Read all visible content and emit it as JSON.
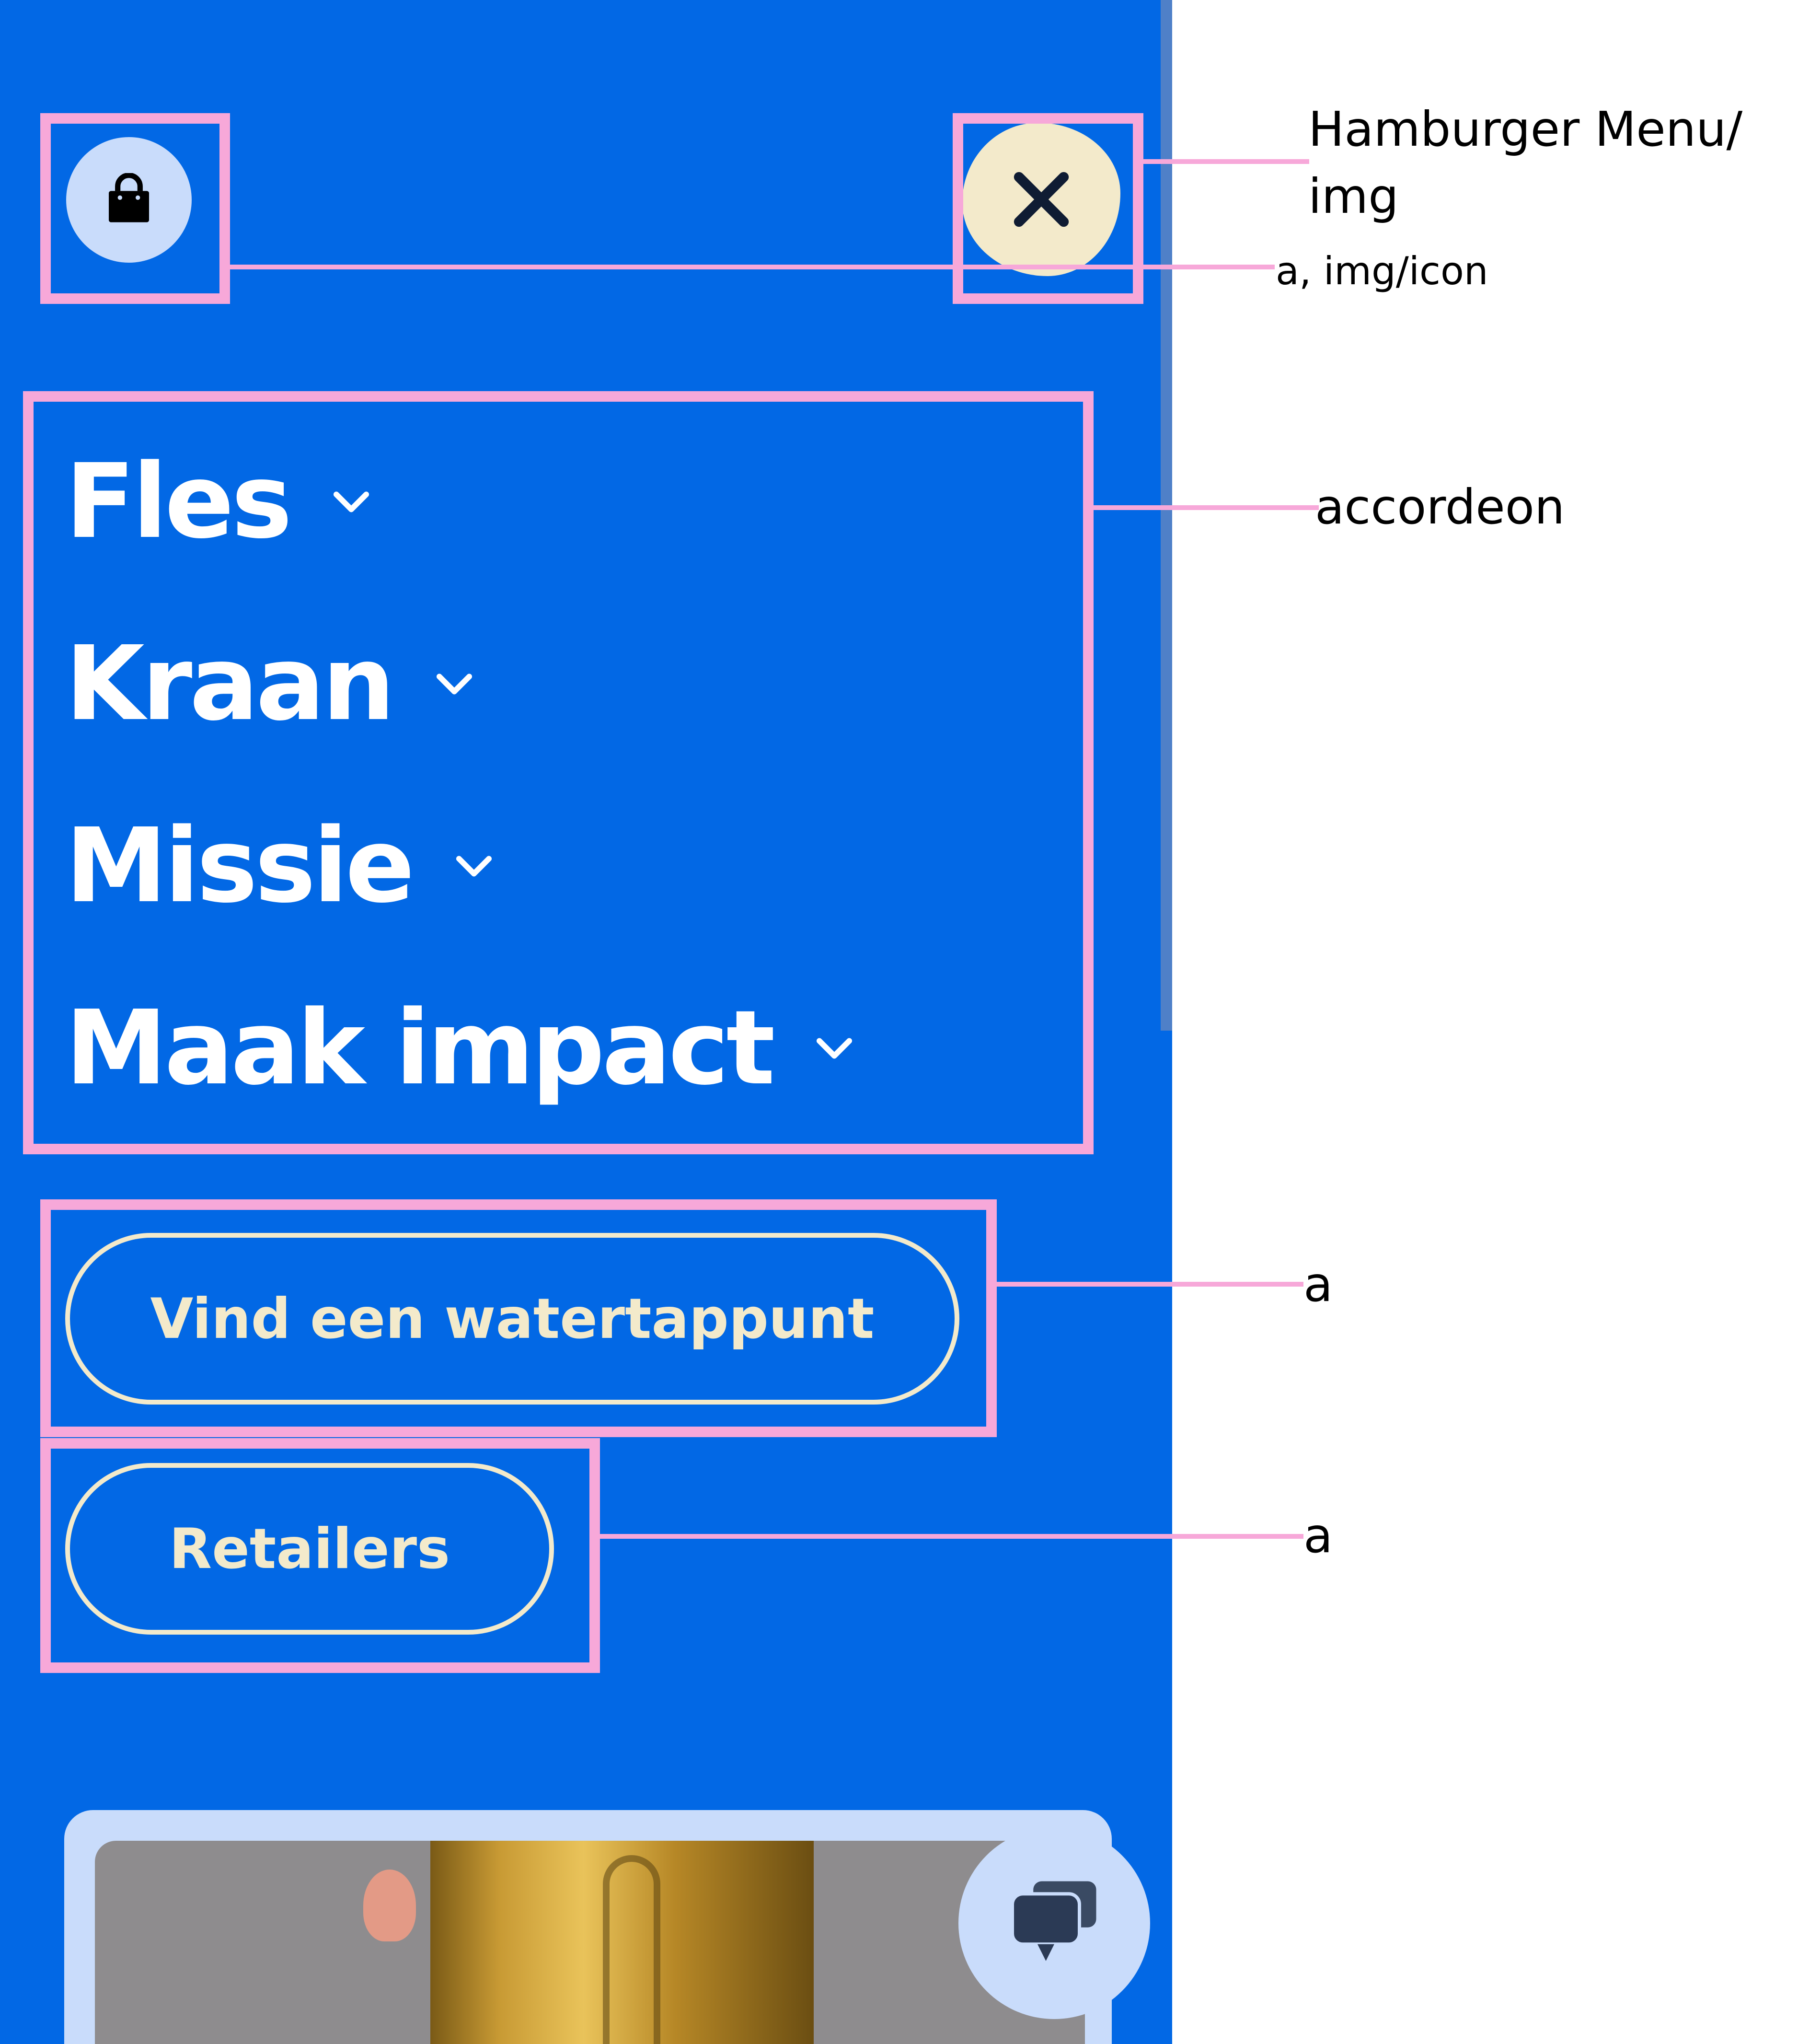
{
  "menu": {
    "cart_icon": "shopping-bag-icon",
    "close_icon": "close-icon",
    "accordion": [
      {
        "label": "Fles"
      },
      {
        "label": "Kraan"
      },
      {
        "label": "Missie"
      },
      {
        "label": "Maak impact"
      }
    ],
    "find_tap_label": "Vind een watertappunt",
    "retailers_label": "Retailers",
    "chat_icon": "chat-bubble-icon"
  },
  "annotations": {
    "hamburger_line1": "Hamburger Menu/",
    "hamburger_line2": "img",
    "icon_link": "a, img/icon",
    "accordion": "accordeon",
    "link_find": "a",
    "link_retailers": "a"
  },
  "colors": {
    "panel_blue": "#0268e5",
    "cream": "#f3eacb",
    "light_blue": "#c9dcfb",
    "highlight_pink": "#f7a8d9"
  }
}
